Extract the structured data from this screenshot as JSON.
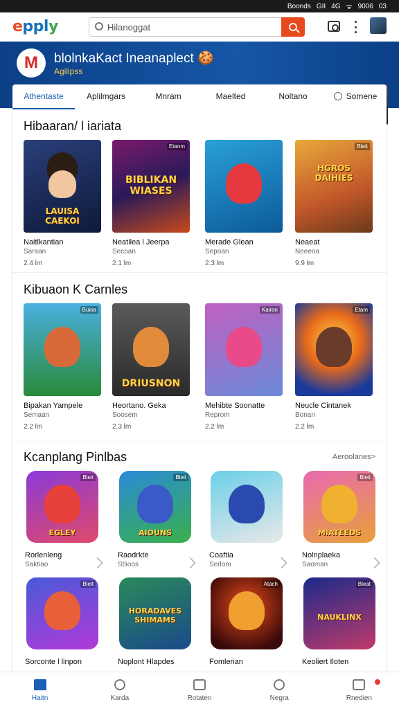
{
  "status_bar": {
    "carrier": "Boonds",
    "signal": "GII",
    "network": "4G",
    "wifi": "ᯤ",
    "time": "9006",
    "battery": "03"
  },
  "topbar": {
    "logo_e": "e",
    "logo_ap": "ppl",
    "logo_y": "y",
    "search_placeholder": "Hilanoggat"
  },
  "banner": {
    "logo_letter": "M",
    "title": "blolnkaKact Ineanaplect 🍪",
    "subtitle": "Agilipss"
  },
  "tabs": [
    "Athentaste",
    "Aplilmgars",
    "Mnram",
    "Maelted",
    "Noltano",
    "Somene"
  ],
  "sections": [
    {
      "title": "Hibaaran/ l iariata",
      "items": [
        {
          "name": "Naitlkantian",
          "sub": "Saraan",
          "size": "2.4 lm",
          "caption": "LAUISA CAEKOI",
          "tag": ""
        },
        {
          "name": "Neatilea l Jeerpa",
          "sub": "Secoan",
          "size": "2.1 lm",
          "caption": "BIBLIKAN WIASES",
          "tag": "Etanm"
        },
        {
          "name": "Merade Glean",
          "sub": "Sepoan",
          "size": "2.3 lm",
          "caption": "",
          "tag": ""
        },
        {
          "name": "Neaeat",
          "sub": "Neeeoa",
          "size": "9.9 lm",
          "caption": "HGROS DAIHIES",
          "tag": "Bleit"
        }
      ]
    },
    {
      "title": "Kibuaon K Carnles",
      "items": [
        {
          "name": "Bipakan Yampele",
          "sub": "Semaan",
          "size": "2.2 lm",
          "caption": "",
          "tag": "Buioa"
        },
        {
          "name": "Heortano. Geka",
          "sub": "Soosem",
          "size": "2.3 lm",
          "caption": "DRIUSNON",
          "tag": ""
        },
        {
          "name": "Mehibte Soonatte",
          "sub": "Reprom",
          "size": "2.2 lm",
          "caption": "",
          "tag": "Kairon"
        },
        {
          "name": "Neucle Cintanek",
          "sub": "Bonan",
          "size": "2.2 lm",
          "caption": "",
          "tag": "Etam"
        }
      ]
    },
    {
      "title": "Kcanplang Pinlbas",
      "more": "Aeroolanes>",
      "items": [
        {
          "name": "Rorlenleng",
          "sub": "Saktiao",
          "caption": "EGLEY",
          "tag": "Bleit"
        },
        {
          "name": "Raodrkte",
          "sub": "Stlioos",
          "caption": "AIOUNS",
          "tag": "Bleit"
        },
        {
          "name": "Coaftia",
          "sub": "Serlom",
          "caption": "",
          "tag": ""
        },
        {
          "name": "Nolnplaeka",
          "sub": "Saoman",
          "caption": "MIATEEDS",
          "tag": "Bleit"
        },
        {
          "name": "Sorconte l linpon",
          "sub": "",
          "caption": "",
          "tag": "Bleit"
        },
        {
          "name": "Noplont Hlapdes",
          "sub": "",
          "caption": "HORADAVES SHIMAMS",
          "tag": ""
        },
        {
          "name": "Fomlerian",
          "sub": "",
          "caption": "",
          "tag": "Atach"
        },
        {
          "name": "Keoliert Iloten",
          "sub": "",
          "caption": "NAUKLINX",
          "tag": "Bleat"
        }
      ]
    }
  ],
  "bottom_nav": [
    "Haitn",
    "Karda",
    "Rotaten",
    "Negra",
    "Rnedien"
  ],
  "colors": {
    "accent": "#1a5fb4",
    "brand_orange": "#e8491d",
    "banner": "#0b3f86"
  }
}
